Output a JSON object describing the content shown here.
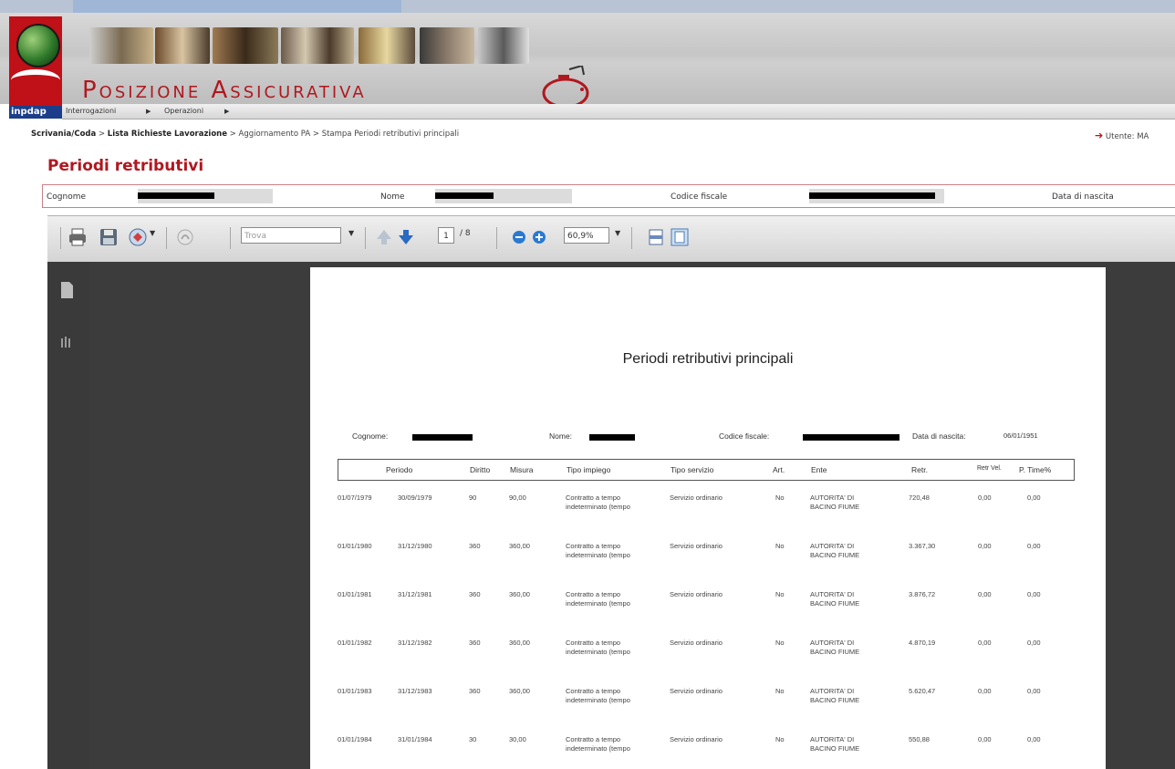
{
  "app": {
    "brand_title": "Posizione Assicurativa",
    "logo_text": "inpdap",
    "colors": {
      "brand_red": "#b01820",
      "logo_blue": "#1c3e8a"
    }
  },
  "menu": {
    "items": [
      {
        "label": "Interrogazioni"
      },
      {
        "label": "Operazioni"
      }
    ]
  },
  "breadcrumb": {
    "items": [
      "Scrivania/Coda",
      "Lista Richieste Lavorazione",
      "Aggiornamento PA",
      "Stampa Periodi retributivi principali"
    ],
    "separator": ">"
  },
  "user": {
    "label": "Utente: MA"
  },
  "page": {
    "title": "Periodi retributivi"
  },
  "person": {
    "cognome_label": "Cognome",
    "nome_label": "Nome",
    "codice_fiscale_label": "Codice fiscale",
    "data_nascita_label": "Data di nascita"
  },
  "pdf_toolbar": {
    "find_placeholder": "Trova",
    "page_current": "1",
    "page_total": "/ 8",
    "zoom": "60,9%",
    "icons": [
      "print-icon",
      "save-icon",
      "email-icon",
      "sign-icon",
      "find-dropdown",
      "prev-page-icon",
      "next-page-icon",
      "zoom-out-icon",
      "zoom-in-icon",
      "fit-width-icon",
      "fit-page-icon"
    ]
  },
  "pdf_sidebar": {
    "icons": [
      "pages-icon",
      "attachments-icon"
    ]
  },
  "document": {
    "title": "Periodi retributivi principali",
    "cognome_label": "Cognome:",
    "nome_label": "Nome:",
    "codice_fiscale_label": "Codice fiscale:",
    "data_nascita_label": "Data di nascita:",
    "data_nascita_value": "06/01/1951",
    "columns": [
      "Periodo",
      "Diritto",
      "Misura",
      "Tipo impiego",
      "Tipo servizio",
      "Art.",
      "Ente",
      "Retr.",
      "Retr Vel.",
      "P. Time%"
    ],
    "rows": [
      {
        "dal": "01/07/1979",
        "al": "30/09/1979",
        "diritto": "90",
        "misura": "90,00",
        "tipo_impiego_1": "Contratto a tempo",
        "tipo_impiego_2": "indeterminato (tempo",
        "tipo_servizio": "Servizio ordinario",
        "art": "No",
        "ente_1": "AUTORITA' DI",
        "ente_2": "BACINO FIUME",
        "retr": "720,48",
        "retr_vel": "0,00",
        "ptime": "0,00"
      },
      {
        "dal": "01/01/1980",
        "al": "31/12/1980",
        "diritto": "360",
        "misura": "360,00",
        "tipo_impiego_1": "Contratto a tempo",
        "tipo_impiego_2": "indeterminato (tempo",
        "tipo_servizio": "Servizio ordinario",
        "art": "No",
        "ente_1": "AUTORITA' DI",
        "ente_2": "BACINO FIUME",
        "retr": "3.367,30",
        "retr_vel": "0,00",
        "ptime": "0,00"
      },
      {
        "dal": "01/01/1981",
        "al": "31/12/1981",
        "diritto": "360",
        "misura": "360,00",
        "tipo_impiego_1": "Contratto a tempo",
        "tipo_impiego_2": "indeterminato (tempo",
        "tipo_servizio": "Servizio ordinario",
        "art": "No",
        "ente_1": "AUTORITA' DI",
        "ente_2": "BACINO FIUME",
        "retr": "3.876,72",
        "retr_vel": "0,00",
        "ptime": "0,00"
      },
      {
        "dal": "01/01/1982",
        "al": "31/12/1982",
        "diritto": "360",
        "misura": "360,00",
        "tipo_impiego_1": "Contratto a tempo",
        "tipo_impiego_2": "indeterminato (tempo",
        "tipo_servizio": "Servizio ordinario",
        "art": "No",
        "ente_1": "AUTORITA' DI",
        "ente_2": "BACINO FIUME",
        "retr": "4.870,19",
        "retr_vel": "0,00",
        "ptime": "0,00"
      },
      {
        "dal": "01/01/1983",
        "al": "31/12/1983",
        "diritto": "360",
        "misura": "360,00",
        "tipo_impiego_1": "Contratto a tempo",
        "tipo_impiego_2": "indeterminato (tempo",
        "tipo_servizio": "Servizio ordinario",
        "art": "No",
        "ente_1": "AUTORITA' DI",
        "ente_2": "BACINO FIUME",
        "retr": "5.620,47",
        "retr_vel": "0,00",
        "ptime": "0,00"
      },
      {
        "dal": "01/01/1984",
        "al": "31/01/1984",
        "diritto": "30",
        "misura": "30,00",
        "tipo_impiego_1": "Contratto a tempo",
        "tipo_impiego_2": "indeterminato (tempo",
        "tipo_servizio": "Servizio ordinario",
        "art": "No",
        "ente_1": "AUTORITA' DI",
        "ente_2": "BACINO FIUME",
        "retr": "550,88",
        "retr_vel": "0,00",
        "ptime": "0,00"
      }
    ]
  }
}
